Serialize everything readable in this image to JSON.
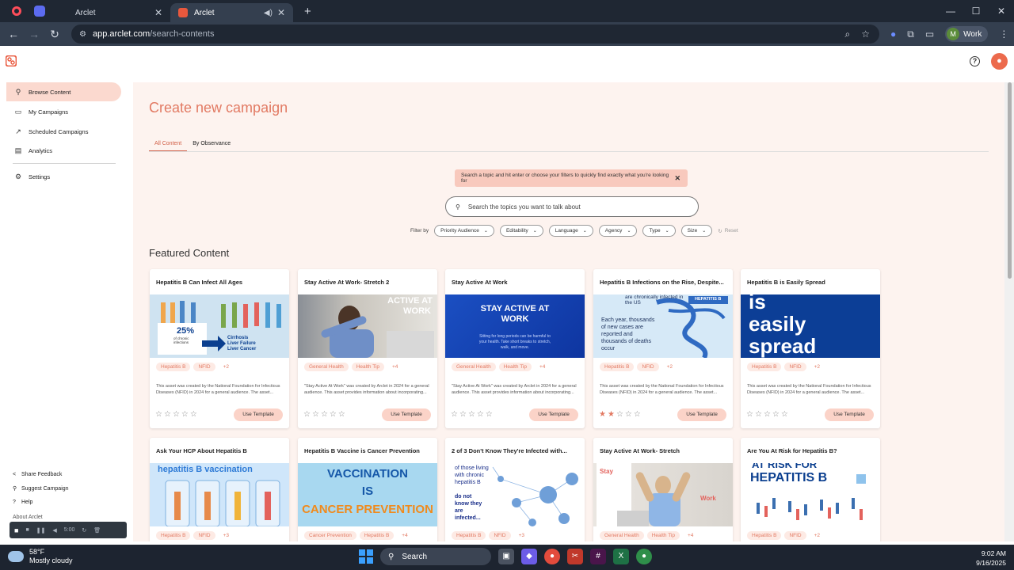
{
  "browser": {
    "tabs": [
      {
        "title": "Arclet",
        "active": false
      },
      {
        "title": "Arclet",
        "active": true
      }
    ],
    "new_tab": "+",
    "url_host": "app.arclet.com",
    "url_path": "/search-contents",
    "profile_initial": "M",
    "profile_label": "Work",
    "window_controls": [
      "—",
      "☐",
      "✕"
    ]
  },
  "header": {
    "help_label": "?",
    "user_icon": "person-icon"
  },
  "sidebar": {
    "items": [
      {
        "label": "Browse Content",
        "icon": "search-icon",
        "active": true
      },
      {
        "label": "My Campaigns",
        "icon": "folder-icon",
        "active": false
      },
      {
        "label": "Scheduled Campaigns",
        "icon": "trend-icon",
        "active": false
      },
      {
        "label": "Analytics",
        "icon": "chart-icon",
        "active": false
      },
      {
        "label": "Settings",
        "icon": "gear-icon",
        "active": false
      }
    ],
    "footer": [
      {
        "label": "Share Feedback",
        "icon": "share-icon"
      },
      {
        "label": "Suggest Campaign",
        "icon": "pin-icon"
      },
      {
        "label": "Help",
        "icon": "help-icon"
      }
    ],
    "about": "About Arclet"
  },
  "main": {
    "title": "Create new campaign",
    "tabs": [
      {
        "label": "All Content",
        "active": true
      },
      {
        "label": "By Observance",
        "active": false
      }
    ],
    "hint": "Search a topic and hit enter or choose your filters to quickly find exactly what you're looking for",
    "search_placeholder": "Search the topics you want to talk about",
    "filter_label": "Filter by",
    "filters": [
      "Priority Audience",
      "Editability",
      "Language",
      "Agency",
      "Type",
      "Size"
    ],
    "reset_label": "Reset",
    "featured_heading": "Featured Content",
    "use_template_label": "Use Template"
  },
  "cards": [
    {
      "title": "Hepatitis B Can Infect All Ages",
      "tags": [
        "Hepatitis B",
        "NFID",
        "+2"
      ],
      "desc": "This asset was created by the National Foundation for Infectious Diseases (NFID) in 2024 for a general audience. The asset...",
      "rating": 0,
      "img_text": [
        "25%",
        "of chronic infections",
        "Cirrhosis",
        "Liver Failure",
        "Liver Cancer"
      ]
    },
    {
      "title": "Stay Active At Work- Stretch 2",
      "tags": [
        "General Health",
        "Health Tip",
        "+4"
      ],
      "desc": "\"Stay Active At Work\" was created by Arclet in 2024 for a general audience. This asset provides information about incorporating...",
      "rating": 0,
      "img_text": [
        "ACTIVE AT",
        "WORK"
      ]
    },
    {
      "title": "Stay Active At Work",
      "tags": [
        "General Health",
        "Health Tip",
        "+4"
      ],
      "desc": "\"Stay Active At Work\" was created by Arclet in 2024 for a general audience. This asset provides information about incorporating...",
      "rating": 0,
      "img_text": [
        "STAY ACTIVE AT",
        "WORK",
        "Sitting for long periods can be harmful to your health. Take short breaks to stretch, walk, and move."
      ]
    },
    {
      "title": "Hepatitis B Infections on the Rise, Despite...",
      "tags": [
        "Hepatitis B",
        "NFID",
        "+2"
      ],
      "desc": "This asset was created by the National Foundation for Infectious Diseases (NFID) in 2024 for a general audience. The asset...",
      "rating": 2,
      "img_text": [
        "are chronically infected in the US",
        "HEPATITIS B",
        "Each year, thousands of new cases are reported and thousands of deaths occur"
      ]
    },
    {
      "title": "Hepatitis B is Easily Spread",
      "tags": [
        "Hepatitis B",
        "NFID",
        "+2"
      ],
      "desc": "This asset was created by the National Foundation for Infectious Diseases (NFID) in 2024 for a general audience. The asset...",
      "rating": 0,
      "img_text": [
        "is",
        "easily",
        "spread"
      ]
    },
    {
      "title": "Ask Your HCP About Hepatitis B",
      "tags": [
        "Hepatitis B",
        "NFID",
        "+3"
      ],
      "img_text": [
        "hepatitis B vaccination"
      ]
    },
    {
      "title": "Hepatitis B Vaccine is Cancer Prevention",
      "tags": [
        "Cancer Prevention",
        "Hepatitis B",
        "+4"
      ],
      "img_text": [
        "VACCINATION",
        "IS",
        "CANCER PREVENTION"
      ]
    },
    {
      "title": "2 of 3 Don't Know They're Infected with...",
      "tags": [
        "Hepatitis B",
        "NFID",
        "+3"
      ],
      "img_text": [
        "of those living with chronic hepatitis B",
        "do not know they are infected..."
      ]
    },
    {
      "title": "Stay Active At Work- Stretch",
      "tags": [
        "General Health",
        "Health Tip",
        "+4"
      ],
      "img_text": [
        "Stay",
        "Work"
      ]
    },
    {
      "title": "Are You At Risk for Hepatitis B?",
      "tags": [
        "Hepatitis B",
        "NFID",
        "+2"
      ],
      "img_text": [
        "AT RISK FOR",
        "HEPATITIS B"
      ]
    }
  ],
  "recorder": {
    "time": "5:00"
  },
  "taskbar": {
    "temp": "58°F",
    "weather": "Mostly cloudy",
    "search_label": "Search",
    "time": "9:02 AM",
    "date": "9/16/2025"
  },
  "colors": {
    "accent": "#e27a63",
    "active_nav": "#fbd9cf",
    "main_bg": "#fdf3ef"
  }
}
